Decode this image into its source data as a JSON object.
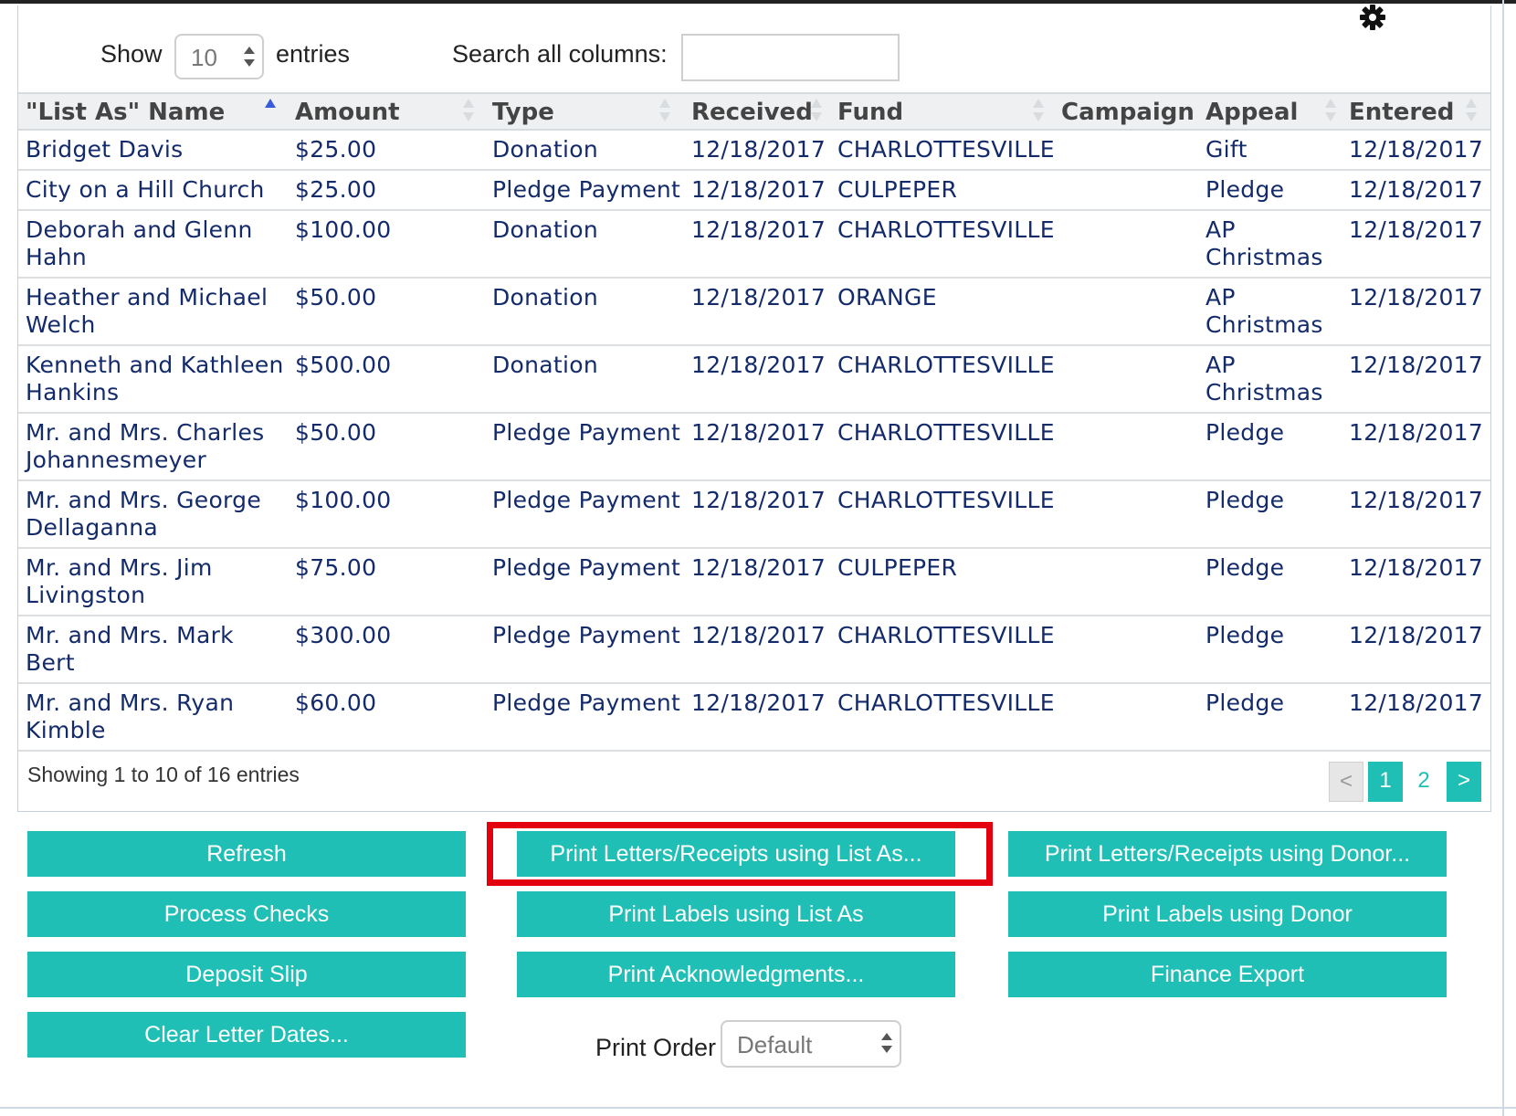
{
  "toolbar": {
    "show_label": "Show",
    "page_length": "10",
    "entries_label": "entries",
    "search_label": "Search all columns:",
    "search_value": ""
  },
  "icons": {
    "settings": "gear-icon"
  },
  "table": {
    "columns": [
      "\"List As\" Name",
      "Amount",
      "Type",
      "Received",
      "Fund",
      "Campaign",
      "Appeal",
      "Entered"
    ],
    "sorted_column": "\"List As\" Name",
    "sort_direction": "ascending",
    "rows": [
      {
        "name": [
          "Bridget Davis"
        ],
        "amount": "$25.00",
        "type": "Donation",
        "received": "12/18/2017",
        "fund": "CHARLOTTESVILLE",
        "campaign": "",
        "appeal": [
          "Gift"
        ],
        "entered": "12/18/2017"
      },
      {
        "name": [
          "City on a Hill Church"
        ],
        "amount": "$25.00",
        "type": "Pledge Payment",
        "received": "12/18/2017",
        "fund": "CULPEPER",
        "campaign": "",
        "appeal": [
          "Pledge"
        ],
        "entered": "12/18/2017"
      },
      {
        "name": [
          "Deborah and Glenn",
          "Hahn"
        ],
        "amount": "$100.00",
        "type": "Donation",
        "received": "12/18/2017",
        "fund": "CHARLOTTESVILLE",
        "campaign": "",
        "appeal": [
          "AP",
          "Christmas"
        ],
        "entered": "12/18/2017"
      },
      {
        "name": [
          "Heather and Michael",
          "Welch"
        ],
        "amount": "$50.00",
        "type": "Donation",
        "received": "12/18/2017",
        "fund": "ORANGE",
        "campaign": "",
        "appeal": [
          "AP",
          "Christmas"
        ],
        "entered": "12/18/2017"
      },
      {
        "name": [
          "Kenneth and Kathleen",
          "Hankins"
        ],
        "amount": "$500.00",
        "type": "Donation",
        "received": "12/18/2017",
        "fund": "CHARLOTTESVILLE",
        "campaign": "",
        "appeal": [
          "AP",
          "Christmas"
        ],
        "entered": "12/18/2017"
      },
      {
        "name": [
          "Mr. and Mrs. Charles",
          "Johannesmeyer"
        ],
        "amount": "$50.00",
        "type": "Pledge Payment",
        "received": "12/18/2017",
        "fund": "CHARLOTTESVILLE",
        "campaign": "",
        "appeal": [
          "Pledge"
        ],
        "entered": "12/18/2017"
      },
      {
        "name": [
          "Mr. and Mrs. George",
          "Dellaganna"
        ],
        "amount": "$100.00",
        "type": "Pledge Payment",
        "received": "12/18/2017",
        "fund": "CHARLOTTESVILLE",
        "campaign": "",
        "appeal": [
          "Pledge"
        ],
        "entered": "12/18/2017"
      },
      {
        "name": [
          "Mr. and Mrs. Jim",
          "Livingston"
        ],
        "amount": "$75.00",
        "type": "Pledge Payment",
        "received": "12/18/2017",
        "fund": "CULPEPER",
        "campaign": "",
        "appeal": [
          "Pledge"
        ],
        "entered": "12/18/2017"
      },
      {
        "name": [
          "Mr. and Mrs. Mark",
          "Bert"
        ],
        "amount": "$300.00",
        "type": "Pledge Payment",
        "received": "12/18/2017",
        "fund": "CHARLOTTESVILLE",
        "campaign": "",
        "appeal": [
          "Pledge"
        ],
        "entered": "12/18/2017"
      },
      {
        "name": [
          "Mr. and Mrs. Ryan",
          "Kimble"
        ],
        "amount": "$60.00",
        "type": "Pledge Payment",
        "received": "12/18/2017",
        "fund": "CHARLOTTESVILLE",
        "campaign": "",
        "appeal": [
          "Pledge"
        ],
        "entered": "12/18/2017"
      }
    ]
  },
  "footer": {
    "info": "Showing 1 to 10 of 16 entries",
    "pagination": {
      "prev": "<",
      "pages": [
        "1",
        "2"
      ],
      "current": "1",
      "next": ">"
    }
  },
  "actions": {
    "refresh": "Refresh",
    "print_letters_list_as": "Print Letters/Receipts using List As...",
    "print_letters_donor": "Print Letters/Receipts using Donor...",
    "process_checks": "Process Checks",
    "print_labels_list_as": "Print Labels using List As",
    "print_labels_donor": "Print Labels using Donor",
    "deposit_slip": "Deposit Slip",
    "print_acknowledgments": "Print Acknowledgments...",
    "finance_export": "Finance Export",
    "clear_letter_dates": "Clear Letter Dates..."
  },
  "print_order": {
    "label": "Print Order",
    "value": "Default"
  },
  "colors": {
    "accent": "#20bfb5",
    "highlight": "#e3000f",
    "link_text": "#142b6b",
    "sort_active": "#3a5bd9"
  }
}
